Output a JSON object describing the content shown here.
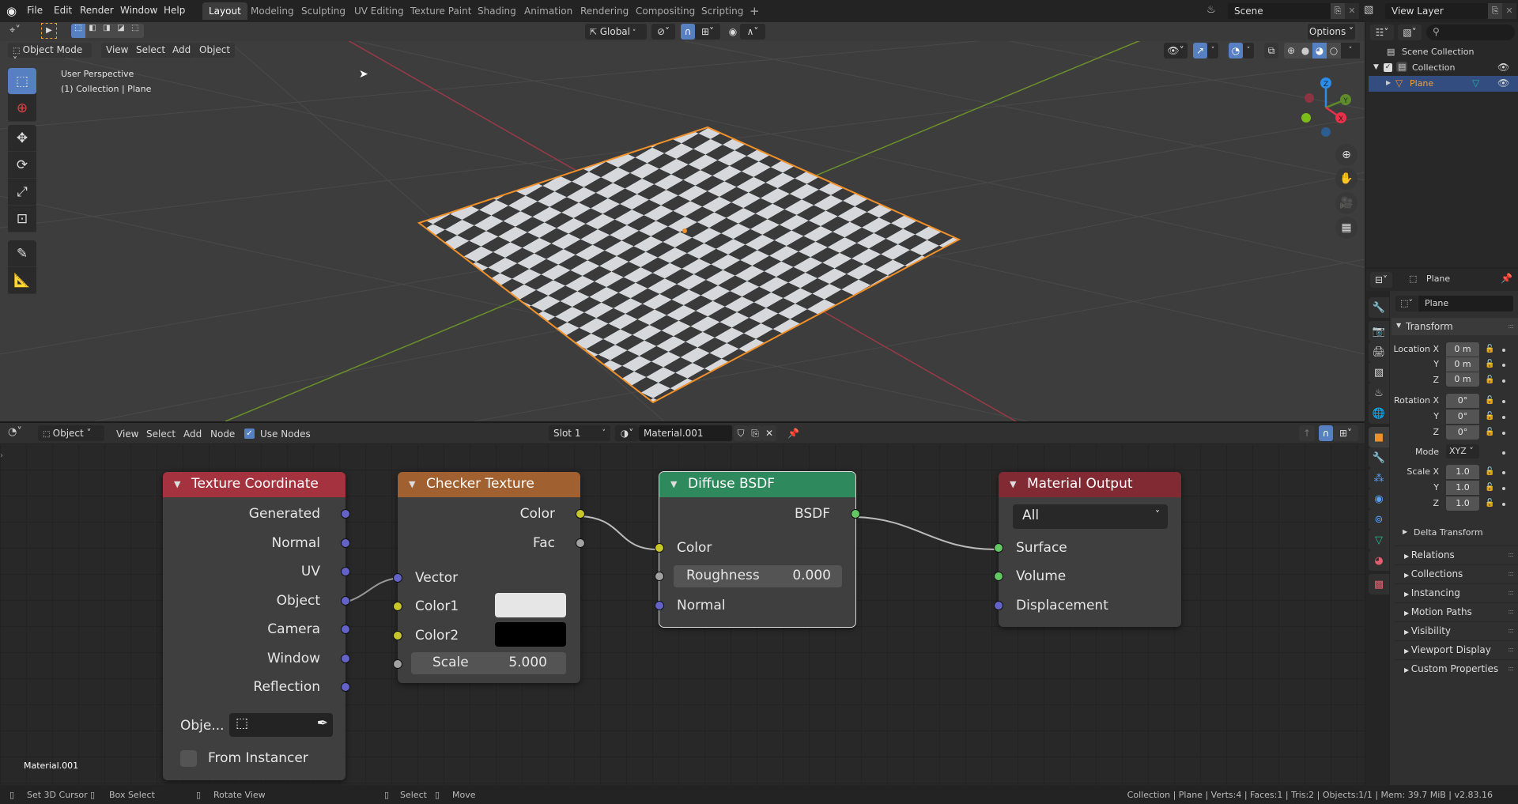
{
  "topbar": {
    "menus": [
      "File",
      "Edit",
      "Render",
      "Window",
      "Help"
    ],
    "workspaces": [
      "Layout",
      "Modeling",
      "Sculpting",
      "UV Editing",
      "Texture Paint",
      "Shading",
      "Animation",
      "Rendering",
      "Compositing",
      "Scripting"
    ],
    "active_workspace": "Layout",
    "add_workspace": "+",
    "scene_name": "Scene",
    "view_layer_name": "View Layer"
  },
  "viewport": {
    "transform_orientation": "Global",
    "options_label": "Options",
    "mode": "Object Mode",
    "menus": [
      "View",
      "Select",
      "Add",
      "Object"
    ],
    "overlay_title": "User Perspective",
    "overlay_subtitle": "(1) Collection | Plane",
    "gizmo_axes": {
      "x": "X",
      "y": "Y",
      "z": "Z"
    },
    "tools": [
      "select-box",
      "cursor",
      "move",
      "rotate",
      "scale",
      "transform",
      "annotate",
      "measure"
    ]
  },
  "outliner": {
    "root": "Scene Collection",
    "collection": "Collection",
    "object": "Plane"
  },
  "properties": {
    "header_object": "Plane",
    "object_name": "Plane",
    "transform_title": "Transform",
    "location_label": "Location X",
    "rotation_label": "Rotation X",
    "scale_label": "Scale X",
    "y_label": "Y",
    "z_label": "Z",
    "location": [
      "0 m",
      "0 m",
      "0 m"
    ],
    "rotation": [
      "0°",
      "0°",
      "0°"
    ],
    "mode_label": "Mode",
    "mode_value": "XYZ",
    "scale": [
      "1.0",
      "1.0",
      "1.0"
    ],
    "delta_transform": "Delta Transform",
    "panels": [
      "Relations",
      "Collections",
      "Instancing",
      "Motion Paths",
      "Visibility",
      "Viewport Display",
      "Custom Properties"
    ]
  },
  "node_editor": {
    "type": "Object",
    "menus": [
      "View",
      "Select",
      "Add",
      "Node"
    ],
    "use_nodes_label": "Use Nodes",
    "use_nodes": true,
    "slot": "Slot 1",
    "material": "Material.001",
    "material_label": "Material.001"
  },
  "nodes": {
    "texcoord": {
      "title": "Texture Coordinate",
      "outputs": [
        "Generated",
        "Normal",
        "UV",
        "Object",
        "Camera",
        "Window",
        "Reflection"
      ],
      "object_label": "Obje...",
      "from_instancer": "From Instancer",
      "color": "#a5333f"
    },
    "checker": {
      "title": "Checker Texture",
      "outputs": [
        "Color",
        "Fac"
      ],
      "vector": "Vector",
      "color1": "Color1",
      "color2": "Color2",
      "color1_value": "#e6e6e6",
      "color2_value": "#000000",
      "scale_label": "Scale",
      "scale_value": "5.000",
      "color": "#a1602f"
    },
    "diffuse": {
      "title": "Diffuse BSDF",
      "output": "BSDF",
      "color_in": "Color",
      "roughness_label": "Roughness",
      "roughness_value": "0.000",
      "normal": "Normal",
      "color": "#2e8a5c"
    },
    "output": {
      "title": "Material Output",
      "target": "All",
      "inputs": [
        "Surface",
        "Volume",
        "Displacement"
      ],
      "color": "#822a34"
    }
  },
  "statusbar": {
    "hints": [
      "Set 3D Cursor",
      "Box Select",
      "Rotate View",
      "Select",
      "Move"
    ],
    "stats": "Collection | Plane | Verts:4 | Faces:1 | Tris:2 | Objects:1/1 | Mem: 39.7 MiB | v2.83.16"
  }
}
